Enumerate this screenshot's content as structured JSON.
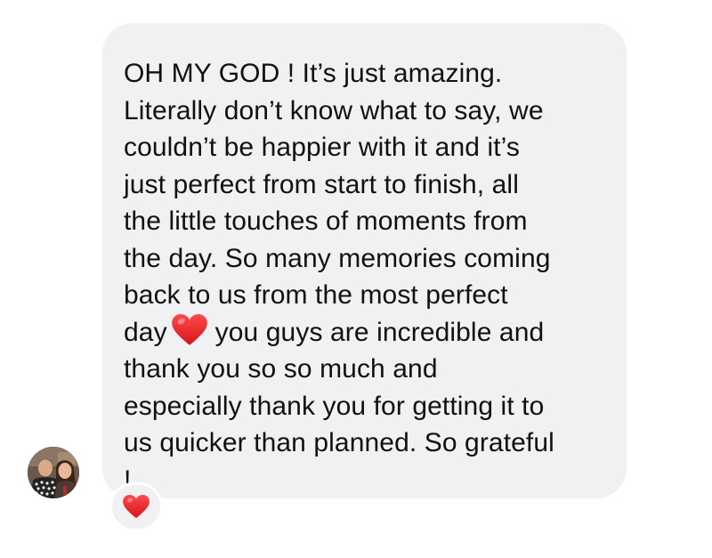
{
  "message": {
    "lines_before_heart": [
      "OH MY GOD ! It’s just amazing.",
      "Literally don’t know what to say, we",
      "couldn’t be happier with it and it’s",
      "just perfect from start to finish, all",
      "the little touches of moments from",
      "the day. So many memories coming",
      "back to us from the most perfect"
    ],
    "heart_line_before": "day",
    "heart_line_after": "you guys are incredible and",
    "lines_after_heart": [
      "thank you so so much and",
      "especially thank you for getting it to",
      "us quicker than planned. So grateful",
      "!"
    ],
    "inline_emoji": "red-heart-icon"
  },
  "reaction": {
    "emoji": "red-heart-icon"
  },
  "sender": {
    "avatar": "profile-photo"
  },
  "colors": {
    "bubble": "#f1f1f3",
    "text": "#111111",
    "heart": "#e0191f"
  }
}
